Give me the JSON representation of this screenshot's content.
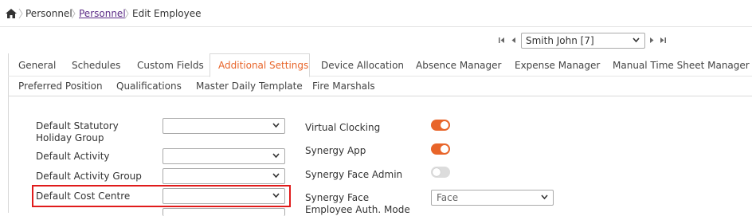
{
  "breadcrumb": {
    "items": [
      "Personnel",
      "Personnel",
      "Edit Employee"
    ]
  },
  "navigator": {
    "selected_employee": "Smith John [7]",
    "first_icon": "first-page-icon",
    "prev_icon": "prev-icon",
    "next_icon": "next-icon",
    "last_icon": "last-page-icon"
  },
  "tabs": {
    "row1": [
      "General",
      "Schedules",
      "Custom Fields",
      "Additional Settings",
      "Device Allocation",
      "Absence Manager",
      "Expense Manager",
      "Manual Time Sheet Manager"
    ],
    "row2": [
      "Preferred Position",
      "Qualifications",
      "Master Daily Template",
      "Fire Marshals"
    ],
    "active": "Additional Settings"
  },
  "form": {
    "left": [
      {
        "label": "Default Statutory Holiday Group",
        "value": ""
      },
      {
        "label": "Default Activity",
        "value": ""
      },
      {
        "label": "Default Activity Group",
        "value": ""
      },
      {
        "label": "Default Cost Centre",
        "value": ""
      }
    ],
    "right": [
      {
        "label": "Virtual Clocking",
        "on": true
      },
      {
        "label": "Synergy App",
        "on": true
      },
      {
        "label": "Synergy Face Admin",
        "on": false
      }
    ],
    "auth_mode": {
      "label": "Synergy Face Employee Auth. Mode",
      "value": "Face"
    }
  },
  "colors": {
    "accent": "#e8652a",
    "highlight": "#e01b1b",
    "link": "#5b2b86"
  }
}
